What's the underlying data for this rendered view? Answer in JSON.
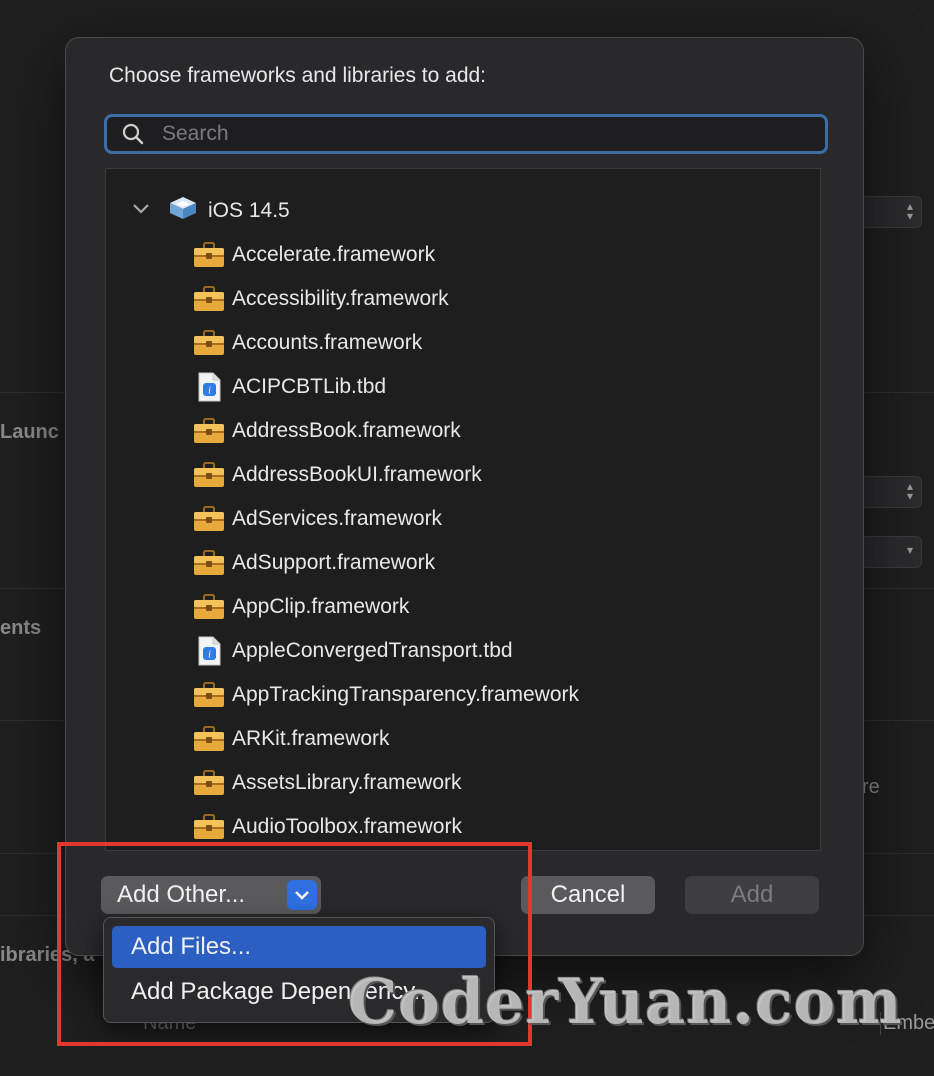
{
  "background": {
    "labels": [
      "Launc",
      "ents",
      "ibraries, a",
      "re"
    ],
    "column_name": "Name",
    "column_embed": "Embe"
  },
  "sheet": {
    "title": "Choose frameworks and libraries to add:",
    "search_placeholder": "Search",
    "group": {
      "label": "iOS 14.5",
      "expanded": true
    },
    "items": [
      {
        "label": "Accelerate.framework",
        "icon": "framework-toolbox-icon"
      },
      {
        "label": "Accessibility.framework",
        "icon": "framework-toolbox-icon"
      },
      {
        "label": "Accounts.framework",
        "icon": "framework-toolbox-icon"
      },
      {
        "label": "ACIPCBTLib.tbd",
        "icon": "tbd-file-icon"
      },
      {
        "label": "AddressBook.framework",
        "icon": "framework-toolbox-icon"
      },
      {
        "label": "AddressBookUI.framework",
        "icon": "framework-toolbox-icon"
      },
      {
        "label": "AdServices.framework",
        "icon": "framework-toolbox-icon"
      },
      {
        "label": "AdSupport.framework",
        "icon": "framework-toolbox-icon"
      },
      {
        "label": "AppClip.framework",
        "icon": "framework-toolbox-icon"
      },
      {
        "label": "AppleConvergedTransport.tbd",
        "icon": "tbd-file-icon"
      },
      {
        "label": "AppTrackingTransparency.framework",
        "icon": "framework-toolbox-icon"
      },
      {
        "label": "ARKit.framework",
        "icon": "framework-toolbox-icon"
      },
      {
        "label": "AssetsLibrary.framework",
        "icon": "framework-toolbox-icon"
      },
      {
        "label": "AudioToolbox.framework",
        "icon": "framework-toolbox-icon"
      }
    ],
    "buttons": {
      "add_other": "Add Other...",
      "cancel": "Cancel",
      "add": "Add"
    }
  },
  "menu": {
    "items": [
      {
        "label": "Add Files...",
        "selected": true
      },
      {
        "label": "Add Package Dependency...",
        "selected": false
      }
    ]
  },
  "watermark": "CoderYuan.com",
  "colors": {
    "accent": "#2f6fe0",
    "selection": "#2c5fc2",
    "annotation": "#e0392e",
    "toolbox": "#e6a93a"
  }
}
